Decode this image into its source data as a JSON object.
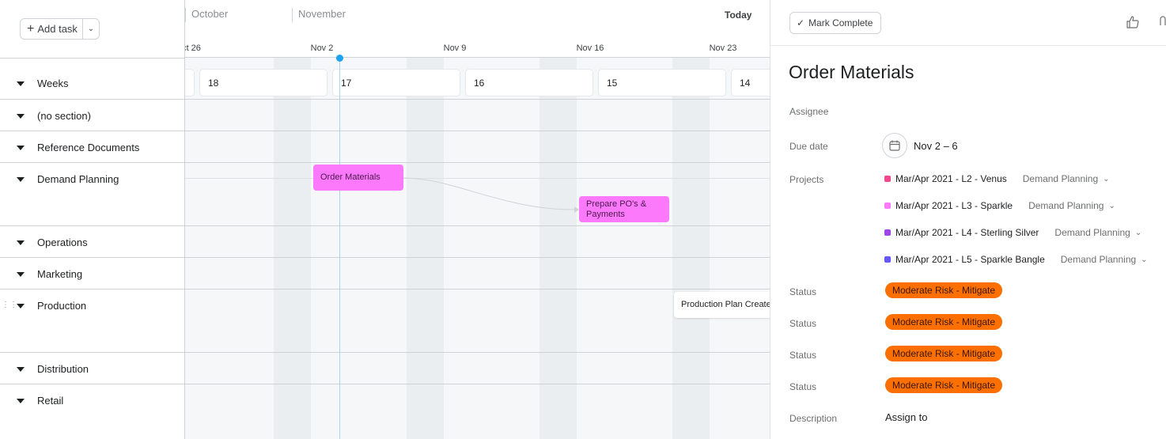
{
  "toolbar": {
    "add_task": "Add task"
  },
  "timeline": {
    "months": [
      "October",
      "November"
    ],
    "weeks": [
      "ct 26",
      "Nov 2",
      "Nov 9",
      "Nov 16",
      "Nov 23"
    ],
    "today": "Today",
    "week_numbers": [
      "18",
      "17",
      "16",
      "15",
      "14"
    ]
  },
  "sections": [
    "Weeks",
    "(no section)",
    "Reference Documents",
    "Demand Planning",
    "Operations",
    "Marketing",
    "Production",
    "Distribution",
    "Retail"
  ],
  "tasks": [
    {
      "name": "Order Materials",
      "color": "#fc79fc"
    },
    {
      "name": "Prepare PO's & Payments",
      "color": "#fc79fc"
    },
    {
      "name": "Production Plan Created",
      "color": "#ffffff"
    }
  ],
  "panel": {
    "mark_complete": "Mark Complete",
    "title": "Order Materials",
    "assignee_label": "Assignee",
    "due_label": "Due date",
    "due_value": "Nov 2 – 6",
    "projects_label": "Projects",
    "projects": [
      {
        "name": "Mar/Apr 2021 - L2 - Venus",
        "section": "Demand Planning",
        "color": "#f0478f"
      },
      {
        "name": "Mar/Apr 2021 - L3 - Sparkle",
        "section": "Demand Planning",
        "color": "#fc79fc"
      },
      {
        "name": "Mar/Apr 2021 - L4 - Sterling Silver",
        "section": "Demand Planning",
        "color": "#a044e6"
      },
      {
        "name": "Mar/Apr 2021 - L5 - Sparkle Bangle",
        "section": "Demand Planning",
        "color": "#6457f9"
      }
    ],
    "statuses": [
      {
        "label": "Status",
        "value": "Moderate Risk - Mitigate"
      },
      {
        "label": "Status",
        "value": "Moderate Risk - Mitigate"
      },
      {
        "label": "Status",
        "value": "Moderate Risk - Mitigate"
      },
      {
        "label": "Status",
        "value": "Moderate Risk - Mitigate"
      }
    ],
    "description_label": "Description",
    "description_value": "Assign to"
  }
}
